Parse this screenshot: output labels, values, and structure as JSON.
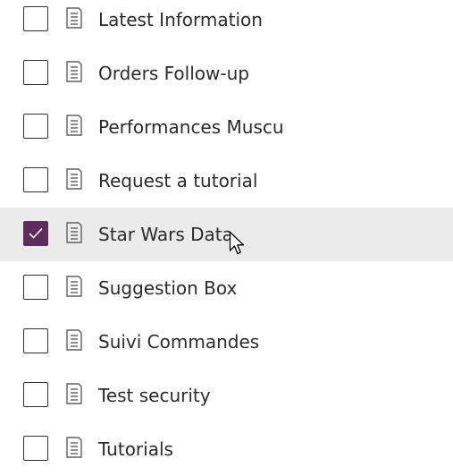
{
  "items": [
    {
      "label": "Latest Information",
      "checked": false
    },
    {
      "label": "Orders Follow-up",
      "checked": false
    },
    {
      "label": "Performances Muscu",
      "checked": false
    },
    {
      "label": "Request a tutorial",
      "checked": false
    },
    {
      "label": "Star Wars Data",
      "checked": true
    },
    {
      "label": "Suggestion Box",
      "checked": false
    },
    {
      "label": "Suivi Commandes",
      "checked": false
    },
    {
      "label": "Test security",
      "checked": false
    },
    {
      "label": "Tutorials",
      "checked": false
    }
  ],
  "colors": {
    "accent": "#5c2d5c",
    "selected_row": "#ebebeb",
    "text": "#2b2b2b",
    "icon": "#616161"
  },
  "icons": {
    "row_icon": "document-list-icon",
    "check": "checkmark-icon",
    "pointer": "mouse-cursor-icon"
  }
}
